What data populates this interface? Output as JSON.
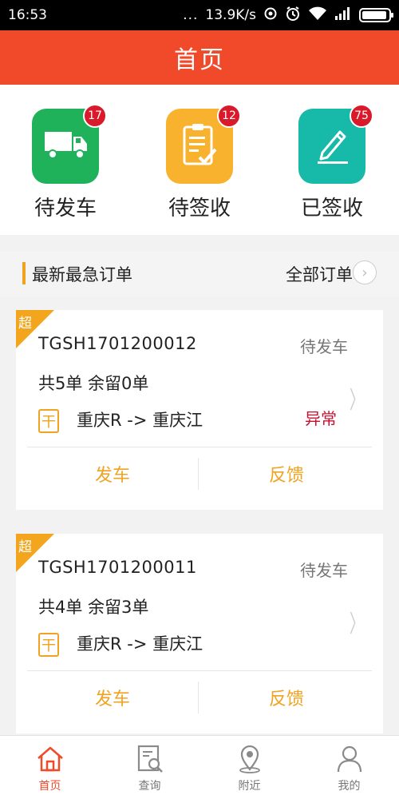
{
  "status_bar": {
    "time": "16:53",
    "dots": "...",
    "speed": "13.9K/s",
    "icons": [
      "sync-icon",
      "alarm-icon",
      "wifi-icon",
      "signal-icon",
      "battery-icon"
    ]
  },
  "header": {
    "title": "首页"
  },
  "quick_actions": [
    {
      "label": "待发车",
      "badge": "17",
      "color": "#1fb25a",
      "icon": "truck-icon"
    },
    {
      "label": "待签收",
      "badge": "12",
      "color": "#f9b22d",
      "icon": "clipboard-check-icon"
    },
    {
      "label": "已签收",
      "badge": "75",
      "color": "#17b9a9",
      "icon": "pen-icon"
    }
  ],
  "section": {
    "title": "最新最急订单",
    "all_label": "全部订单"
  },
  "orders": [
    {
      "corner": "超",
      "order_no": "TGSH1701200012",
      "status": "待发车",
      "count": "共5单 余留0单",
      "route_icon": "干",
      "route": "重庆R -> 重庆江",
      "exception": "异常",
      "btn_left": "发车",
      "btn_right": "反馈"
    },
    {
      "corner": "超",
      "order_no": "TGSH1701200011",
      "status": "待发车",
      "count": "共4单 余留3单",
      "route_icon": "干",
      "route": "重庆R -> 重庆江",
      "exception": "",
      "btn_left": "发车",
      "btn_right": "反馈"
    }
  ],
  "bottom_nav": [
    {
      "label": "首页",
      "icon": "home-icon",
      "active": true
    },
    {
      "label": "查询",
      "icon": "search-doc-icon",
      "active": false
    },
    {
      "label": "附近",
      "icon": "location-pin-icon",
      "active": false
    },
    {
      "label": "我的",
      "icon": "user-icon",
      "active": false
    }
  ],
  "colors": {
    "header": "#f04a2b",
    "accent": "#f0a321",
    "badge": "#d81a2a",
    "exception": "#c8102e"
  }
}
